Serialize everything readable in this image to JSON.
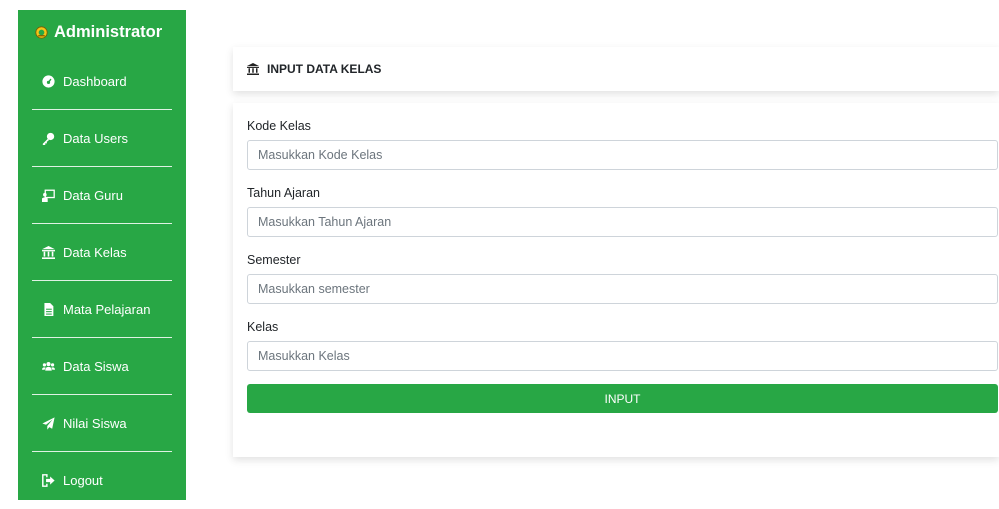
{
  "sidebar": {
    "brand": {
      "title": "Administrator",
      "icon": "emblem-icon"
    },
    "items": [
      {
        "label": "Dashboard",
        "icon": "dashboard-icon"
      },
      {
        "label": "Data Users",
        "icon": "key-icon"
      },
      {
        "label": "Data Guru",
        "icon": "chalkboard-teacher-icon"
      },
      {
        "label": "Data Kelas",
        "icon": "landmark-icon"
      },
      {
        "label": "Mata Pelajaran",
        "icon": "file-icon"
      },
      {
        "label": "Data Siswa",
        "icon": "users-icon"
      },
      {
        "label": "Nilai Siswa",
        "icon": "paper-plane-icon"
      },
      {
        "label": "Logout",
        "icon": "sign-out-icon"
      }
    ]
  },
  "header": {
    "title": "INPUT DATA KELAS",
    "icon": "landmark-icon"
  },
  "form": {
    "fields": [
      {
        "label": "Kode Kelas",
        "placeholder": "Masukkan Kode Kelas",
        "value": ""
      },
      {
        "label": "Tahun Ajaran",
        "placeholder": "Masukkan Tahun Ajaran",
        "value": ""
      },
      {
        "label": "Semester",
        "placeholder": "Masukkan semester",
        "value": ""
      },
      {
        "label": "Kelas",
        "placeholder": "Masukkan Kelas",
        "value": ""
      }
    ],
    "submit_label": "INPUT"
  },
  "colors": {
    "accent": "#28a745",
    "text": "#212529",
    "border": "#ced4da"
  }
}
